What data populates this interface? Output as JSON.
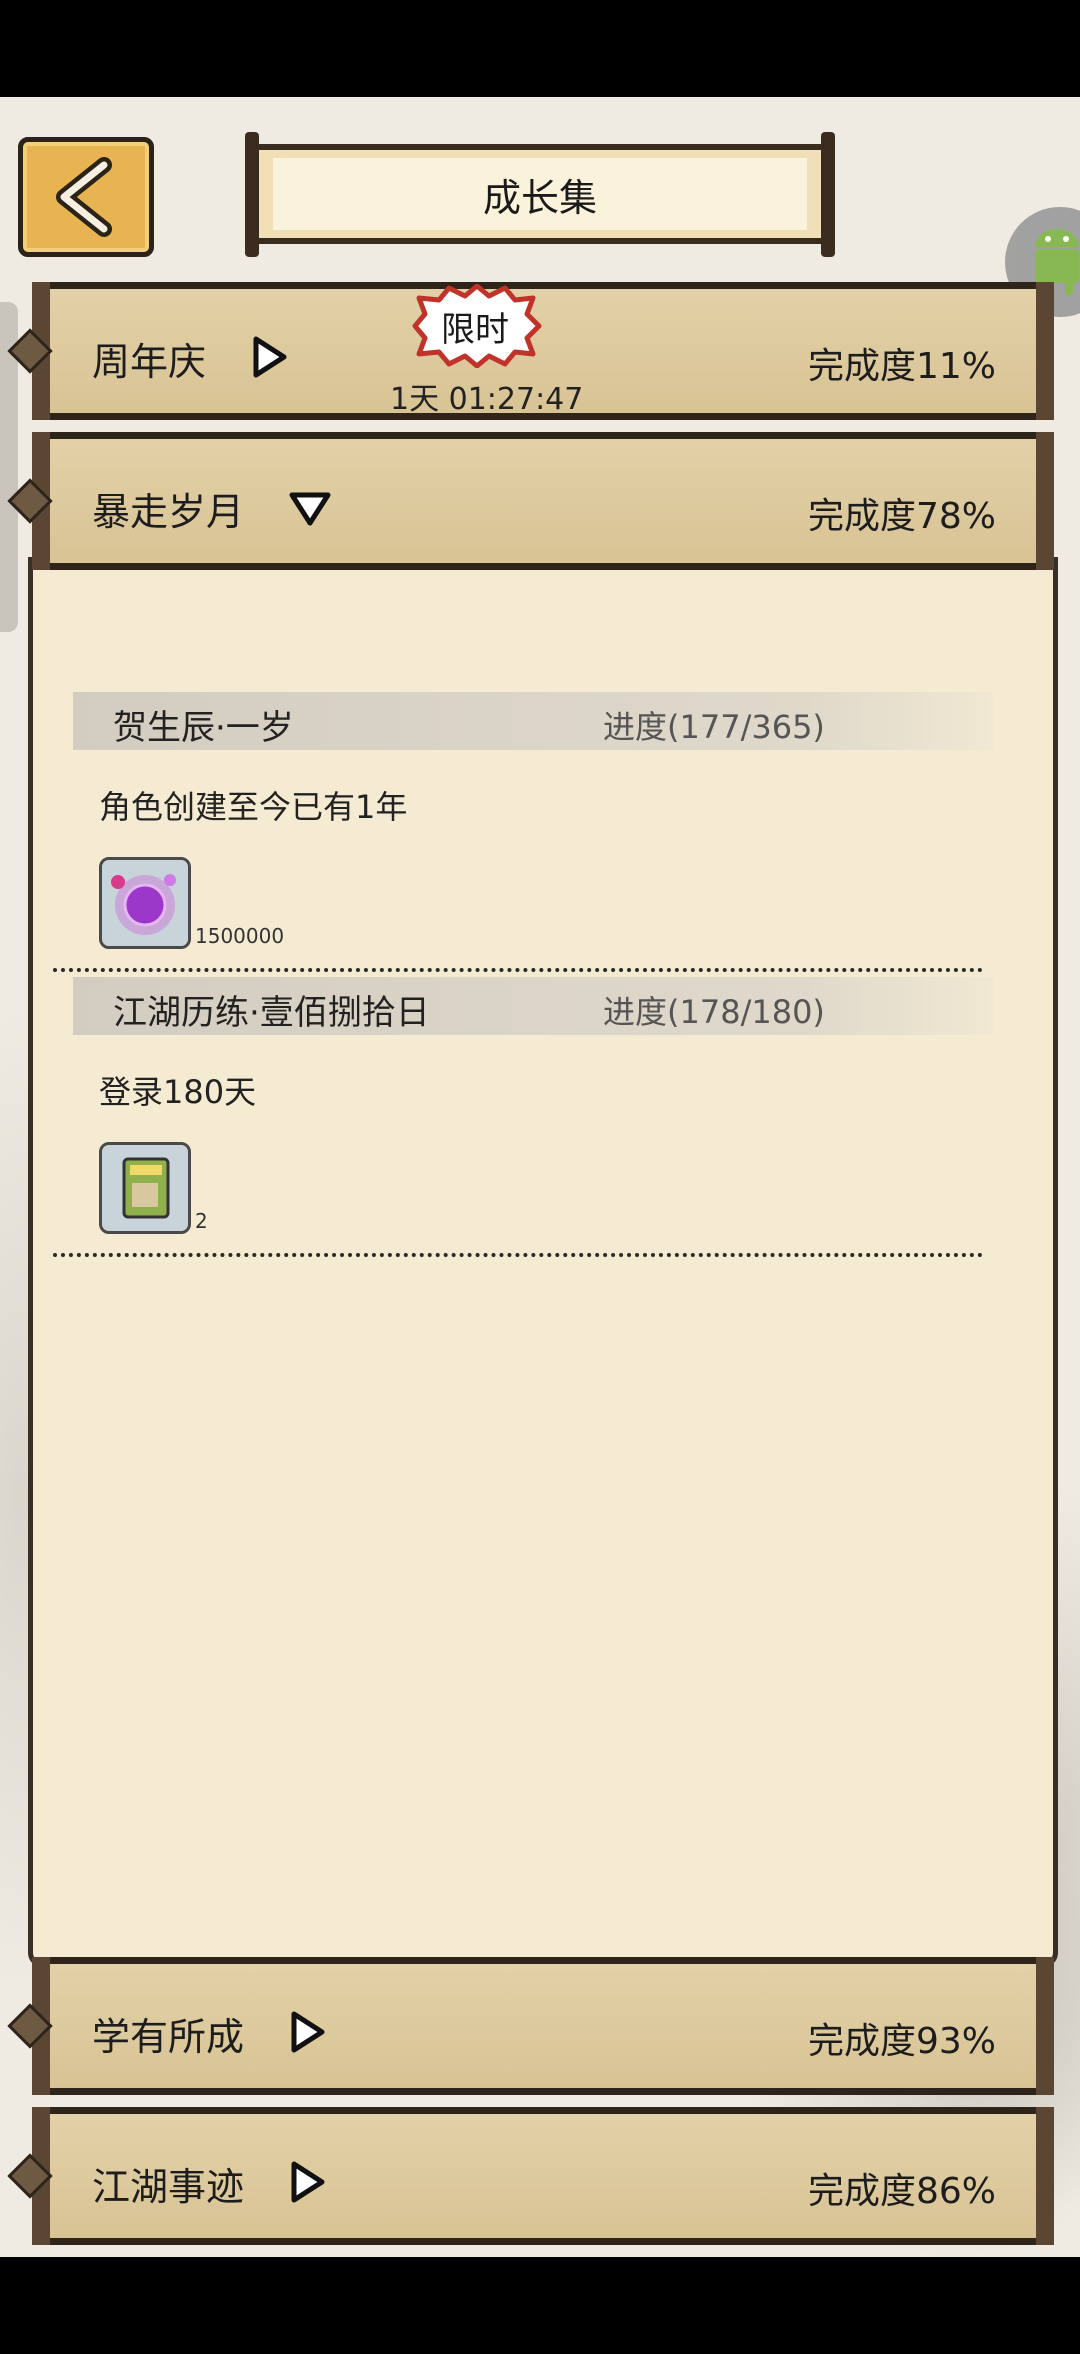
{
  "header": {
    "title": "成长集"
  },
  "categories": [
    {
      "name": "周年庆",
      "completion": "完成度11%",
      "badge": "限时",
      "timer": "1天 01:27:47"
    },
    {
      "name": "暴走岁月",
      "completion": "完成度78%"
    },
    {
      "name": "学有所成",
      "completion": "完成度93%"
    },
    {
      "name": "江湖事迹",
      "completion": "完成度86%"
    }
  ],
  "achievements": [
    {
      "title": "贺生辰·一岁",
      "progress": "进度(177/365)",
      "desc": "角色创建至今已有1年",
      "reward_count": "1500000",
      "reward_icon": "purple-orb-icon"
    },
    {
      "title": "江湖历练·壹佰捌拾日",
      "progress": "进度(178/180)",
      "desc": "登录180天",
      "reward_count": "2",
      "reward_icon": "item-pack-icon"
    }
  ],
  "colors": {
    "bar": "#dcc79a",
    "panel": "#f5ead2",
    "ink": "#2e241a",
    "back_button": "#e8b451"
  }
}
